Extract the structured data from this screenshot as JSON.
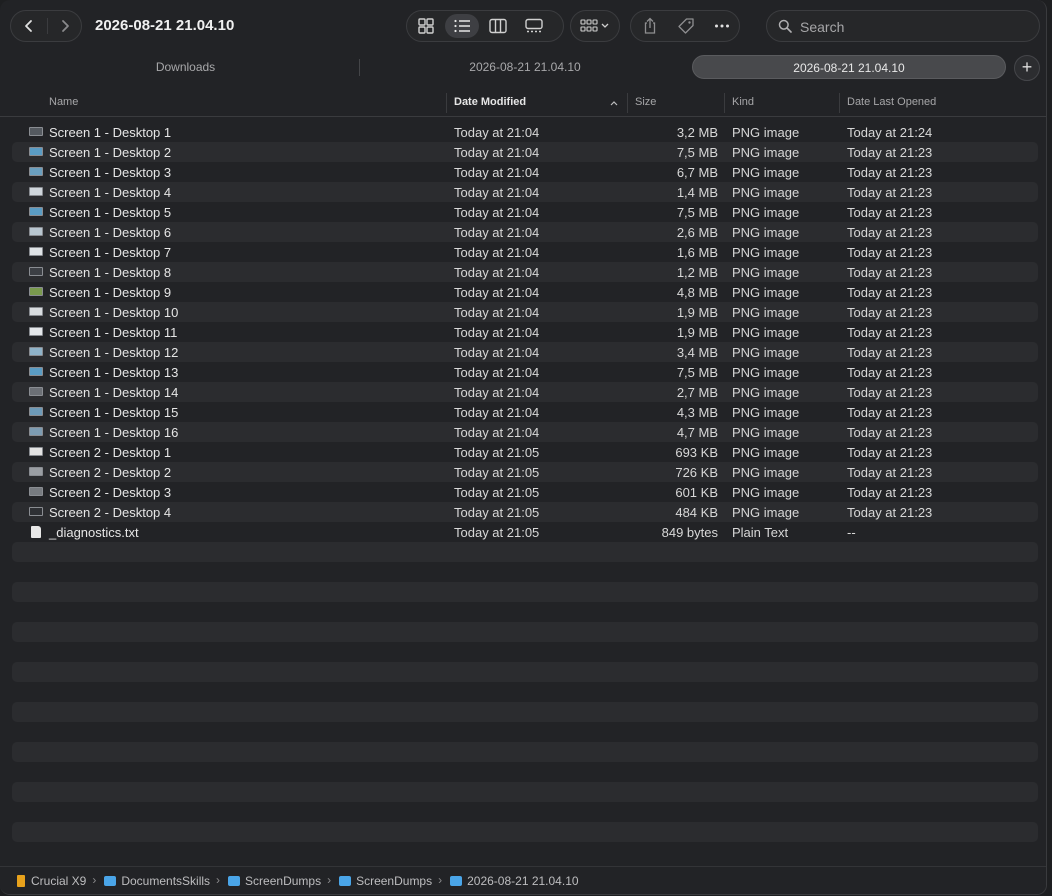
{
  "window": {
    "title": "2026-08-21 21.04.10"
  },
  "search": {
    "placeholder": "Search"
  },
  "tabs": [
    {
      "label": "Downloads"
    },
    {
      "label": "2026-08-21 21.04.10"
    },
    {
      "label": "2026-08-21 21.04.10",
      "active": true
    }
  ],
  "tab_add": "+",
  "columns": {
    "name": "Name",
    "date_modified": "Date Modified",
    "size": "Size",
    "kind": "Kind",
    "date_last_opened": "Date Last Opened"
  },
  "files": [
    {
      "name": "Screen 1 - Desktop 1",
      "date": "Today at 21:04",
      "size": "3,2 MB",
      "kind": "PNG image",
      "opened": "Today at 21:24",
      "icon": "png-icon",
      "thumb": "#555a60"
    },
    {
      "name": "Screen 1 - Desktop 2",
      "date": "Today at 21:04",
      "size": "7,5 MB",
      "kind": "PNG image",
      "opened": "Today at 21:23",
      "icon": "png-icon",
      "thumb": "#5a9cc4"
    },
    {
      "name": "Screen 1 - Desktop 3",
      "date": "Today at 21:04",
      "size": "6,7 MB",
      "kind": "PNG image",
      "opened": "Today at 21:23",
      "icon": "png-icon",
      "thumb": "#6a9fbf"
    },
    {
      "name": "Screen 1 - Desktop 4",
      "date": "Today at 21:04",
      "size": "1,4 MB",
      "kind": "PNG image",
      "opened": "Today at 21:23",
      "icon": "png-icon",
      "thumb": "#cfd6dc"
    },
    {
      "name": "Screen 1 - Desktop 5",
      "date": "Today at 21:04",
      "size": "7,5 MB",
      "kind": "PNG image",
      "opened": "Today at 21:23",
      "icon": "png-icon",
      "thumb": "#5a9cc4"
    },
    {
      "name": "Screen 1 - Desktop 6",
      "date": "Today at 21:04",
      "size": "2,6 MB",
      "kind": "PNG image",
      "opened": "Today at 21:23",
      "icon": "png-icon",
      "thumb": "#b8c6d0"
    },
    {
      "name": "Screen 1 - Desktop 7",
      "date": "Today at 21:04",
      "size": "1,6 MB",
      "kind": "PNG image",
      "opened": "Today at 21:23",
      "icon": "png-icon",
      "thumb": "#dfe3e6"
    },
    {
      "name": "Screen 1 - Desktop 8",
      "date": "Today at 21:04",
      "size": "1,2 MB",
      "kind": "PNG image",
      "opened": "Today at 21:23",
      "icon": "png-icon",
      "thumb": "#3c3f44"
    },
    {
      "name": "Screen 1 - Desktop 9",
      "date": "Today at 21:04",
      "size": "4,8 MB",
      "kind": "PNG image",
      "opened": "Today at 21:23",
      "icon": "png-icon",
      "thumb": "#7a9a4e"
    },
    {
      "name": "Screen 1 - Desktop 10",
      "date": "Today at 21:04",
      "size": "1,9 MB",
      "kind": "PNG image",
      "opened": "Today at 21:23",
      "icon": "png-icon",
      "thumb": "#d9dde0"
    },
    {
      "name": "Screen 1 - Desktop 11",
      "date": "Today at 21:04",
      "size": "1,9 MB",
      "kind": "PNG image",
      "opened": "Today at 21:23",
      "icon": "png-icon",
      "thumb": "#e4e7ea"
    },
    {
      "name": "Screen 1 - Desktop 12",
      "date": "Today at 21:04",
      "size": "3,4 MB",
      "kind": "PNG image",
      "opened": "Today at 21:23",
      "icon": "png-icon",
      "thumb": "#8fb3c9"
    },
    {
      "name": "Screen 1 - Desktop 13",
      "date": "Today at 21:04",
      "size": "7,5 MB",
      "kind": "PNG image",
      "opened": "Today at 21:23",
      "icon": "png-icon",
      "thumb": "#5a9cc4"
    },
    {
      "name": "Screen 1 - Desktop 14",
      "date": "Today at 21:04",
      "size": "2,7 MB",
      "kind": "PNG image",
      "opened": "Today at 21:23",
      "icon": "png-icon",
      "thumb": "#6c7076"
    },
    {
      "name": "Screen 1 - Desktop 15",
      "date": "Today at 21:04",
      "size": "4,3 MB",
      "kind": "PNG image",
      "opened": "Today at 21:23",
      "icon": "png-icon",
      "thumb": "#6d9ab8"
    },
    {
      "name": "Screen 1 - Desktop 16",
      "date": "Today at 21:04",
      "size": "4,7 MB",
      "kind": "PNG image",
      "opened": "Today at 21:23",
      "icon": "png-icon",
      "thumb": "#7d9cb2"
    },
    {
      "name": "Screen 2 - Desktop 1",
      "date": "Today at 21:05",
      "size": "693 KB",
      "kind": "PNG image",
      "opened": "Today at 21:23",
      "icon": "png-icon",
      "thumb": "#e3e3e3"
    },
    {
      "name": "Screen 2 - Desktop 2",
      "date": "Today at 21:05",
      "size": "726 KB",
      "kind": "PNG image",
      "opened": "Today at 21:23",
      "icon": "png-icon",
      "thumb": "#9a9ea3"
    },
    {
      "name": "Screen 2 - Desktop 3",
      "date": "Today at 21:05",
      "size": "601 KB",
      "kind": "PNG image",
      "opened": "Today at 21:23",
      "icon": "png-icon",
      "thumb": "#777b80"
    },
    {
      "name": "Screen 2 - Desktop 4",
      "date": "Today at 21:05",
      "size": "484 KB",
      "kind": "PNG image",
      "opened": "Today at 21:23",
      "icon": "png-icon",
      "thumb": "#2e3034"
    },
    {
      "name": "_diagnostics.txt",
      "date": "Today at 21:05",
      "size": "849 bytes",
      "kind": "Plain Text",
      "opened": "--",
      "icon": "text-file-icon",
      "thumb": "#e8e8e8"
    }
  ],
  "path": [
    {
      "label": "Crucial X9",
      "icon": "external-drive-icon"
    },
    {
      "label": "DocumentsSkills",
      "icon": "folder-icon"
    },
    {
      "label": "ScreenDumps",
      "icon": "folder-icon"
    },
    {
      "label": "ScreenDumps",
      "icon": "folder-icon"
    },
    {
      "label": "2026-08-21 21.04.10",
      "icon": "folder-icon"
    }
  ],
  "path_separator": "›"
}
